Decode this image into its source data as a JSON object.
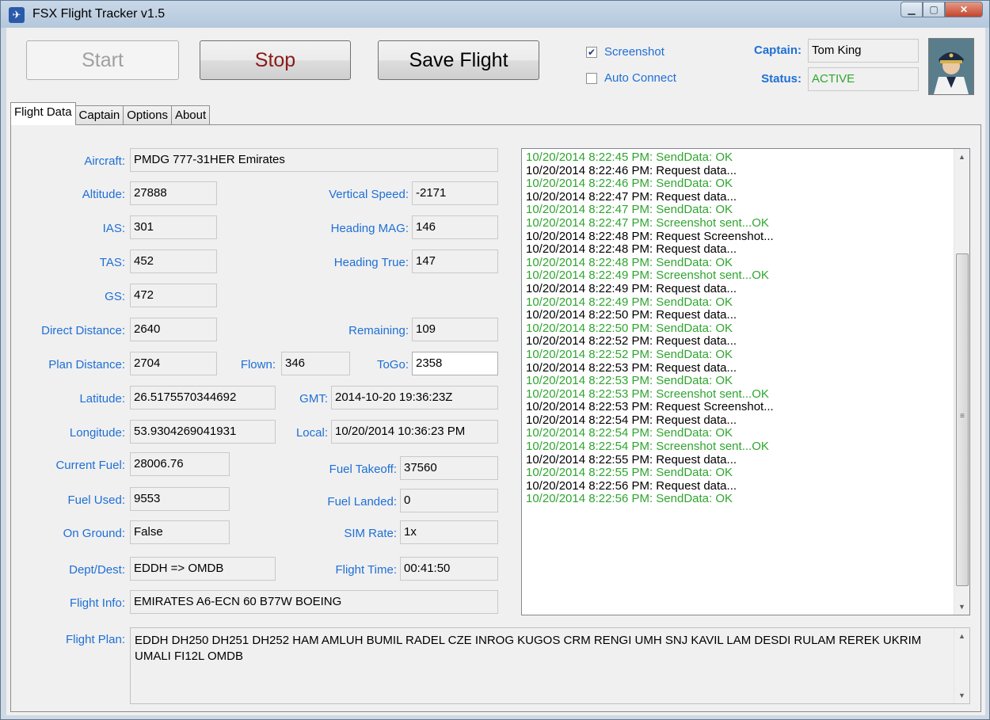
{
  "window": {
    "title": "FSX Flight Tracker v1.5"
  },
  "toolbar": {
    "start_label": "Start",
    "stop_label": "Stop",
    "save_label": "Save Flight",
    "screenshot_label": "Screenshot",
    "screenshot_checked": true,
    "auto_connect_label": "Auto Connect",
    "auto_connect_checked": false,
    "captain_label": "Captain:",
    "captain_value": "Tom King",
    "status_label": "Status:",
    "status_value": "ACTIVE"
  },
  "tabs": [
    {
      "label": "Flight Data",
      "active": true
    },
    {
      "label": "Captain",
      "active": false
    },
    {
      "label": "Options",
      "active": false
    },
    {
      "label": "About",
      "active": false
    }
  ],
  "flight": {
    "aircraft": {
      "label": "Aircraft:",
      "value": "PMDG 777-31HER Emirates"
    },
    "altitude": {
      "label": "Altitude:",
      "value": "27888"
    },
    "vertical_speed": {
      "label": "Vertical Speed:",
      "value": "-2171"
    },
    "ias": {
      "label": "IAS:",
      "value": "301"
    },
    "heading_mag": {
      "label": "Heading MAG:",
      "value": "146"
    },
    "tas": {
      "label": "TAS:",
      "value": "452"
    },
    "heading_true": {
      "label": "Heading True:",
      "value": "147"
    },
    "gs": {
      "label": "GS:",
      "value": "472"
    },
    "direct_distance": {
      "label": "Direct Distance:",
      "value": "2640"
    },
    "remaining": {
      "label": "Remaining:",
      "value": "109"
    },
    "plan_distance": {
      "label": "Plan Distance:",
      "value": "2704"
    },
    "flown": {
      "label": "Flown:",
      "value": "346"
    },
    "togo": {
      "label": "ToGo:",
      "value": "2358"
    },
    "latitude": {
      "label": "Latitude:",
      "value": "26.5175570344692"
    },
    "gmt": {
      "label": "GMT:",
      "value": "2014-10-20 19:36:23Z"
    },
    "longitude": {
      "label": "Longitude:",
      "value": "53.9304269041931"
    },
    "local": {
      "label": "Local:",
      "value": "10/20/2014 10:36:23 PM"
    },
    "current_fuel": {
      "label": "Current Fuel:",
      "value": "28006.76"
    },
    "fuel_takeoff": {
      "label": "Fuel Takeoff:",
      "value": "37560"
    },
    "fuel_used": {
      "label": "Fuel Used:",
      "value": "9553"
    },
    "fuel_landed": {
      "label": "Fuel Landed:",
      "value": "0"
    },
    "on_ground": {
      "label": "On Ground:",
      "value": "False"
    },
    "sim_rate": {
      "label": "SIM Rate:",
      "value": "1x"
    },
    "dept_dest": {
      "label": "Dept/Dest:",
      "value": "EDDH => OMDB"
    },
    "flight_time": {
      "label": "Flight Time:",
      "value": "00:41:50"
    },
    "flight_info": {
      "label": "Flight Info:",
      "value": "EMIRATES A6-ECN 60 B77W BOEING"
    },
    "flight_plan": {
      "label": "Flight Plan:",
      "value": "EDDH DH250 DH251 DH252 HAM AMLUH BUMIL RADEL CZE INROG KUGOS CRM RENGI UMH SNJ KAVIL LAM DESDI RULAM REREK UKRIM UMALI FI12L OMDB"
    }
  },
  "log": [
    {
      "text": "10/20/2014 8:22:45 PM: SendData: OK",
      "kind": "ok"
    },
    {
      "text": "10/20/2014 8:22:46 PM: Request data...",
      "kind": "req"
    },
    {
      "text": "10/20/2014 8:22:46 PM: SendData: OK",
      "kind": "ok"
    },
    {
      "text": "10/20/2014 8:22:47 PM: Request data...",
      "kind": "req"
    },
    {
      "text": "10/20/2014 8:22:47 PM: SendData: OK",
      "kind": "ok"
    },
    {
      "text": "10/20/2014 8:22:47 PM: Screenshot sent...OK",
      "kind": "ok"
    },
    {
      "text": "10/20/2014 8:22:48 PM: Request Screenshot...",
      "kind": "req"
    },
    {
      "text": "10/20/2014 8:22:48 PM: Request data...",
      "kind": "req"
    },
    {
      "text": "10/20/2014 8:22:48 PM: SendData: OK",
      "kind": "ok"
    },
    {
      "text": "10/20/2014 8:22:49 PM: Screenshot sent...OK",
      "kind": "ok"
    },
    {
      "text": "10/20/2014 8:22:49 PM: Request data...",
      "kind": "req"
    },
    {
      "text": "10/20/2014 8:22:49 PM: SendData: OK",
      "kind": "ok"
    },
    {
      "text": "10/20/2014 8:22:50 PM: Request data...",
      "kind": "req"
    },
    {
      "text": "10/20/2014 8:22:50 PM: SendData: OK",
      "kind": "ok"
    },
    {
      "text": "10/20/2014 8:22:52 PM: Request data...",
      "kind": "req"
    },
    {
      "text": "10/20/2014 8:22:52 PM: SendData: OK",
      "kind": "ok"
    },
    {
      "text": "10/20/2014 8:22:53 PM: Request data...",
      "kind": "req"
    },
    {
      "text": "10/20/2014 8:22:53 PM: SendData: OK",
      "kind": "ok"
    },
    {
      "text": "10/20/2014 8:22:53 PM: Screenshot sent...OK",
      "kind": "ok"
    },
    {
      "text": "10/20/2014 8:22:53 PM: Request Screenshot...",
      "kind": "req"
    },
    {
      "text": "10/20/2014 8:22:54 PM: Request data...",
      "kind": "req"
    },
    {
      "text": "10/20/2014 8:22:54 PM: SendData: OK",
      "kind": "ok"
    },
    {
      "text": "10/20/2014 8:22:54 PM: Screenshot sent...OK",
      "kind": "ok"
    },
    {
      "text": "10/20/2014 8:22:55 PM: Request data...",
      "kind": "req"
    },
    {
      "text": "10/20/2014 8:22:55 PM: SendData: OK",
      "kind": "ok"
    },
    {
      "text": "10/20/2014 8:22:56 PM: Request data...",
      "kind": "req"
    },
    {
      "text": "10/20/2014 8:22:56 PM: SendData: OK",
      "kind": "ok"
    }
  ],
  "colors": {
    "label_blue": "#1e6fd6",
    "ok_green": "#2fa52f",
    "stop_red": "#8b1a1a"
  },
  "icons": {
    "app": "airplane-icon",
    "avatar": "captain-avatar"
  }
}
